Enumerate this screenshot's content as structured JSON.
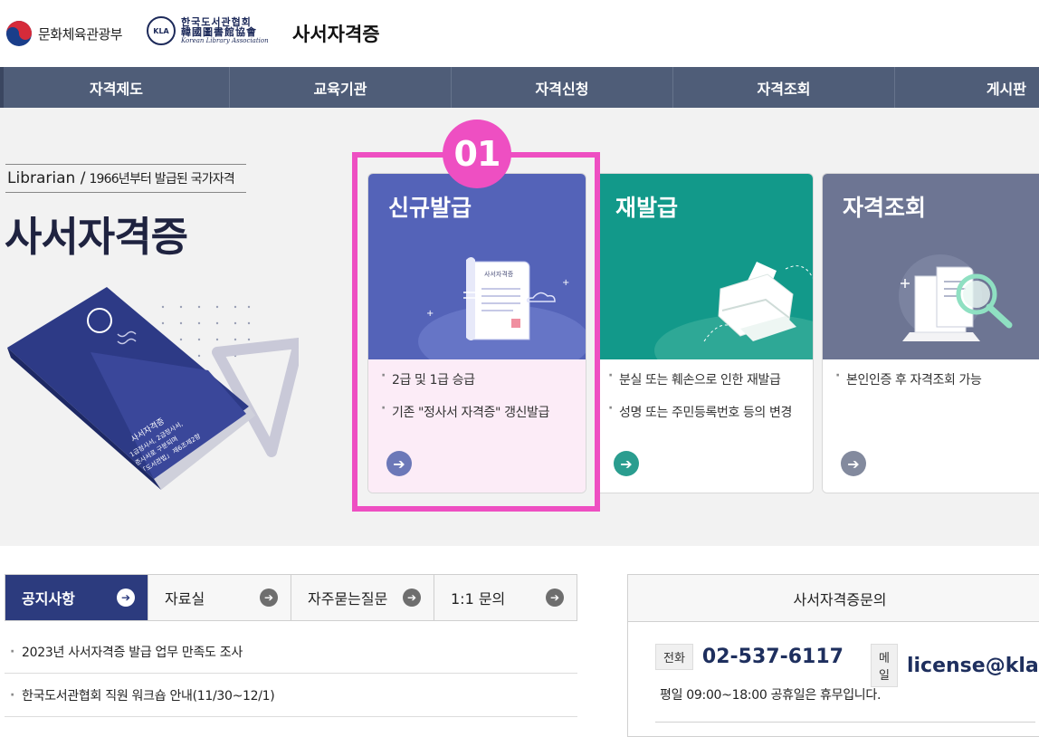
{
  "header": {
    "ministry_label": "문화체육관광부",
    "kla_korean": "한국도서관협회",
    "kla_hanja": "韓國圖書館協會",
    "kla_english": "Korean Library Association",
    "kla_seal": "KLA",
    "site_title": "사서자격증"
  },
  "nav": {
    "items": [
      "자격제도",
      "교육기관",
      "자격신청",
      "자격조회",
      "게시판"
    ]
  },
  "hero": {
    "subtitle_en": "Librarian /",
    "subtitle_ko": "1966년부터 발급된 국가자격",
    "title": "사서자격증",
    "book_text": "사서자격증 1급정사서, 2급정사서, 준사서로 구분되며 「도서관법」 제6조제2항"
  },
  "badge": "01",
  "cards": [
    {
      "title": "신규발급",
      "items": [
        "2급 및 1급 승급",
        "기존 \"정사서 자격증\" 갱신발급"
      ],
      "doc_label": "사서자격증",
      "color_top": "#5463b8",
      "color_bottom": "#fcecf7",
      "arrow_color": "#6c78b8"
    },
    {
      "title": "재발급",
      "items": [
        "분실 또는 훼손으로 인한 재발급",
        "성명 또는 주민등록번호 등의 변경"
      ],
      "color_top": "#12998a",
      "color_bottom": "#ffffff",
      "arrow_color": "#2a9d8f"
    },
    {
      "title": "자격조회",
      "items": [
        "본인인증 후 자격조회 가능"
      ],
      "color_top": "#6d7593",
      "color_bottom": "#ffffff",
      "arrow_color": "#838a9e"
    }
  ],
  "tabs": [
    "공지사항",
    "자료실",
    "자주묻는질문",
    "1:1 문의"
  ],
  "notices": [
    "2023년 사서자격증 발급 업무 만족도 조사",
    "한국도서관협회 직원 워크숍 안내(11/30~12/1)"
  ],
  "contact": {
    "heading": "사서자격증문의",
    "phone_chip": "전화",
    "phone": "02-537-6117",
    "mail_chip": "메일",
    "mail": "license@kla.kr",
    "hours": "평일 09:00~18:00 공휴일은 휴무입니다."
  },
  "colors": {
    "nav": "#4f5d78",
    "highlight": "#ee4fc2",
    "tab_active": "#2c3b7e"
  },
  "icons": [
    "taeguk-logo-icon",
    "kla-seal-icon",
    "arrow-right-icon",
    "certificate-document-icon",
    "printer-icon",
    "magnifier-icon"
  ]
}
